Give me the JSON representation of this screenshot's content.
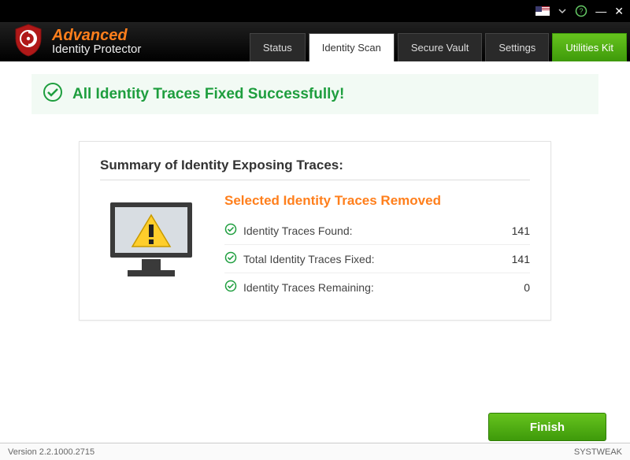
{
  "brand": {
    "line1": "Advanced",
    "line2": "Identity Protector"
  },
  "tabs": {
    "status": "Status",
    "identity_scan": "Identity Scan",
    "secure_vault": "Secure Vault",
    "settings": "Settings",
    "utilities": "Utilities Kit"
  },
  "banner": {
    "text": "All Identity Traces Fixed Successfully!"
  },
  "card": {
    "heading": "Summary of Identity Exposing Traces:",
    "subtitle": "Selected Identity Traces Removed",
    "rows": [
      {
        "label": "Identity Traces Found:",
        "value": "141"
      },
      {
        "label": "Total Identity Traces Fixed:",
        "value": "141"
      },
      {
        "label": "Identity Traces Remaining:",
        "value": "0"
      }
    ]
  },
  "buttons": {
    "finish": "Finish"
  },
  "statusbar": {
    "version": "Version 2.2.1000.2715",
    "watermark": "SYSTWEAK"
  },
  "colors": {
    "accent": "#ff7f1c",
    "success": "#1e9e3e",
    "action": "#4caf19"
  }
}
